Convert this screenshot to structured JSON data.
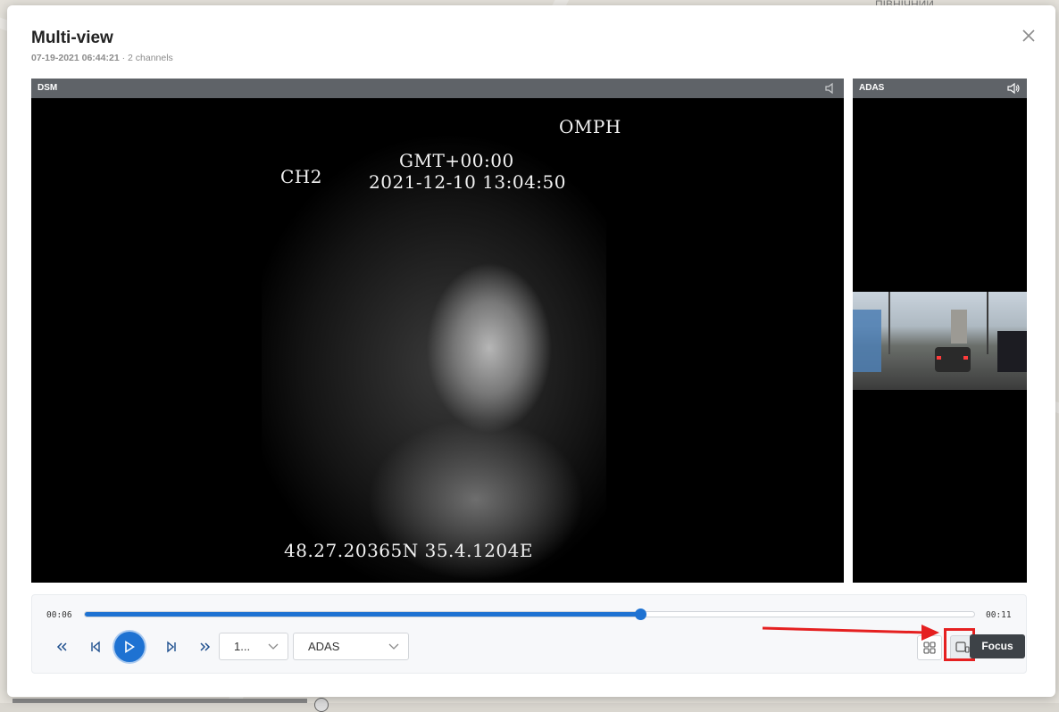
{
  "background_map": {
    "labels": [
      "ПІВНІЧНИЙ"
    ]
  },
  "modal": {
    "title": "Multi-view",
    "timestamp": "07-19-2021 06:44:21",
    "separator": "·",
    "channels_text": "2 channels",
    "close_icon": "close-icon"
  },
  "panels": {
    "dsm": {
      "label": "DSM",
      "speaker_icon": "speaker-muted-icon",
      "osd": {
        "speed": "OMPH",
        "channel": "CH2",
        "timezone": "GMT+00:00",
        "datetime": "2021-12-10 13:04:50",
        "coordinates": "48.27.20365N 35.4.1204E"
      }
    },
    "adas": {
      "label": "ADAS",
      "speaker_icon": "speaker-on-icon"
    }
  },
  "player": {
    "current_time": "00:06",
    "end_time": "00:11",
    "progress_percent": 62.5,
    "speed_select_value": "1...",
    "channel_select_value": "ADAS",
    "grid_icon": "grid-layout-icon",
    "focus_icon": "focus-layout-icon",
    "tooltip": "Focus"
  },
  "colors": {
    "accent": "#1e72d2",
    "annotation": "#e52020"
  }
}
